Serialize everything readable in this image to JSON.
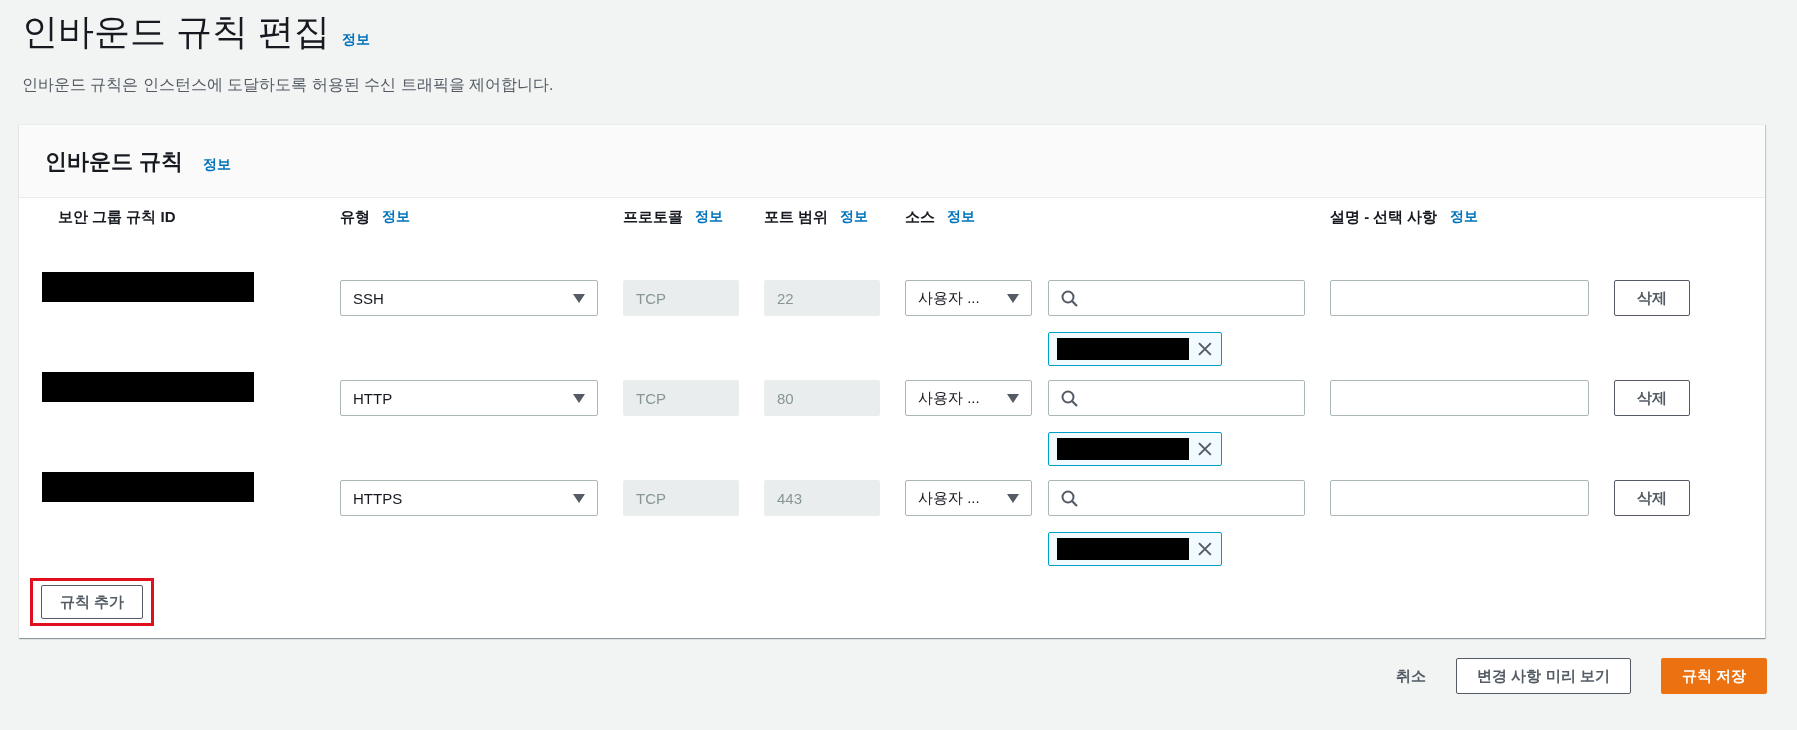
{
  "page": {
    "title": "인바운드 규칙 편집",
    "title_info": "정보",
    "description": "인바운드 규칙은 인스턴스에 도달하도록 허용된 수신 트래픽을 제어합니다."
  },
  "panel": {
    "title": "인바운드 규칙",
    "info": "정보",
    "columns": [
      {
        "label": "보안 그룹 규칙 ID"
      },
      {
        "label": "유형",
        "info": "정보"
      },
      {
        "label": "프로토콜",
        "info": "정보"
      },
      {
        "label": "포트 범위",
        "info": "정보"
      },
      {
        "label": "소스",
        "info": "정보"
      },
      {
        "label": "설명 - 선택 사항",
        "info": "정보"
      }
    ],
    "rows": [
      {
        "type": "SSH",
        "protocol": "TCP",
        "port": "22",
        "source": "사용자 ...",
        "delete": "삭제"
      },
      {
        "type": "HTTP",
        "protocol": "TCP",
        "port": "80",
        "source": "사용자 ...",
        "delete": "삭제"
      },
      {
        "type": "HTTPS",
        "protocol": "TCP",
        "port": "443",
        "source": "사용자 ...",
        "delete": "삭제"
      }
    ],
    "add_button": {
      "label": "규칙 추가",
      "highlighted": true
    }
  },
  "footer": {
    "cancel": "취소",
    "preview": "변경 사항 미리 보기",
    "save": "규칙 저장"
  }
}
